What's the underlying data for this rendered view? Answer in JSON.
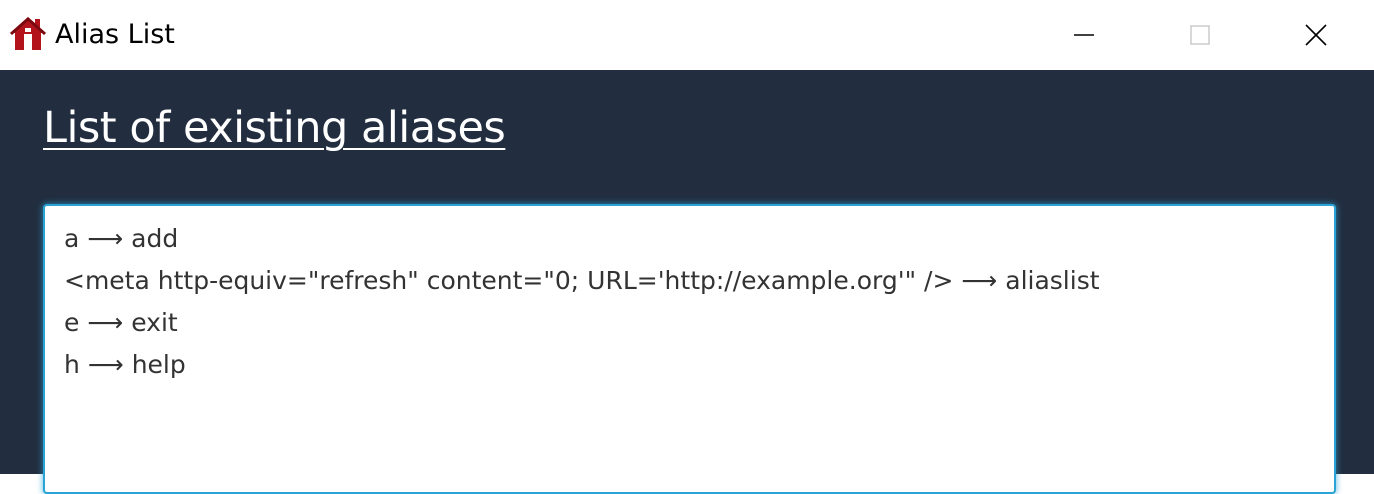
{
  "window": {
    "title": "Alias List",
    "icon": "house-icon",
    "controls": {
      "minimize": "minimize-icon",
      "maximize": "maximize-icon",
      "close": "close-icon"
    }
  },
  "page": {
    "heading": "List of existing aliases"
  },
  "aliases": [
    {
      "alias": "a",
      "arrow": "⟶",
      "command": "add"
    },
    {
      "alias": "<meta http-equiv=\"refresh\" content=\"0; URL='http://example.org'\" />",
      "arrow": "⟶",
      "command": "aliaslist"
    },
    {
      "alias": "e",
      "arrow": "⟶",
      "command": "exit"
    },
    {
      "alias": "h",
      "arrow": "⟶",
      "command": "help"
    }
  ],
  "colors": {
    "background": "#222e40",
    "icon_red": "#b3141c",
    "focus_border": "#2aa3d6",
    "text": "#333333"
  }
}
